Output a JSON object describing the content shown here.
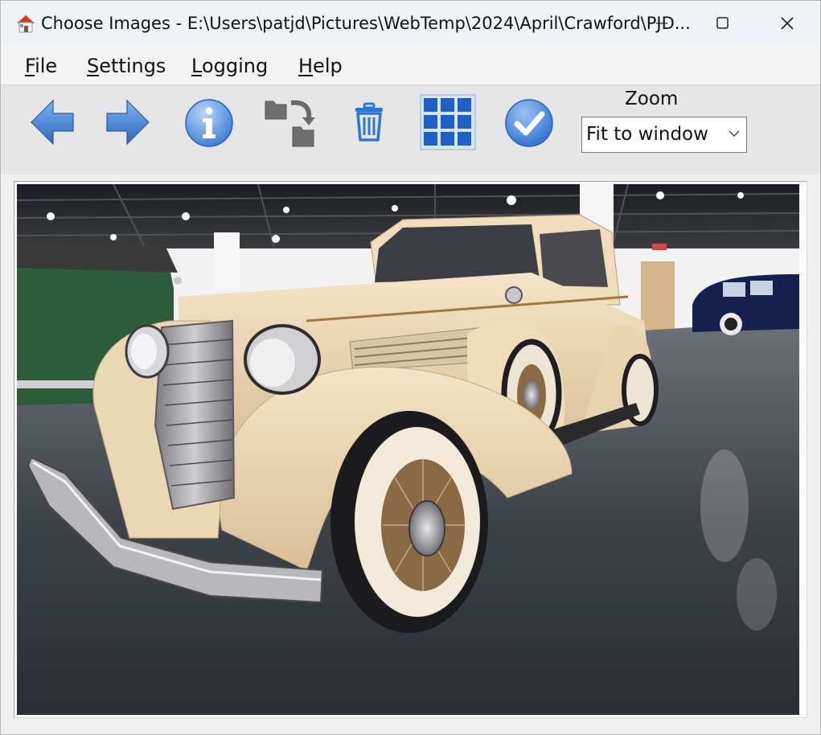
{
  "window": {
    "title": "Choose Images - E:\\Users\\patjd\\Pictures\\WebTemp\\2024\\April\\Crawford\\PJD...",
    "icons": [
      "app-house-icon",
      "minimize-icon",
      "maximize-icon",
      "close-icon"
    ]
  },
  "menu": {
    "items": [
      {
        "accel": "F",
        "rest": "ile"
      },
      {
        "accel": "S",
        "rest": "ettings"
      },
      {
        "accel": "L",
        "rest": "ogging"
      },
      {
        "accel": "H",
        "rest": "elp"
      }
    ]
  },
  "toolbar": {
    "tools": [
      "back-arrow-icon",
      "forward-arrow-icon",
      "info-icon",
      "move-to-folder-icon",
      "trash-icon",
      "grid-view-icon",
      "confirm-check-icon"
    ],
    "zoom_label": "Zoom",
    "zoom_value": "Fit to window"
  },
  "colors": {
    "arrow_blue": "#3f7fd0",
    "icon_blue": "#2a78d6",
    "car_cream": "#e9d4b3",
    "floor_dark": "#34383e"
  }
}
